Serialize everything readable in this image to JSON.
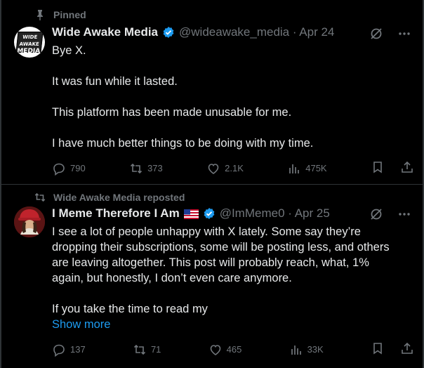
{
  "post1": {
    "context": "Pinned",
    "avatar_text_top": "WIDE AWAKE",
    "avatar_text_bottom": "MEDIA",
    "name": "Wide Awake Media",
    "handle": "@wideawake_media · Apr 24",
    "lines": [
      "Bye X.",
      "It was fun while it lasted.",
      "This platform has been made unusable for me.",
      "I have much better things to be doing with my time."
    ],
    "replies": "790",
    "reposts": "373",
    "likes": "2.1K",
    "views": "475K"
  },
  "post2": {
    "context": "Wide Awake Media reposted",
    "name": "I Meme Therefore I Am",
    "handle": "@ImMeme0 · Apr 25",
    "lines": [
      "I see a lot of people unhappy with X lately. Some say they’re",
      "dropping their subscriptions, some will be posting less, and others",
      "are leaving altogether. This post will probably reach, what, 1%",
      "again, but honestly, I don’t even care anymore.",
      "If you take the time to read my"
    ],
    "show_more": "Show more",
    "replies": "137",
    "reposts": "71",
    "likes": "465",
    "views": "33K"
  },
  "colors": {
    "accent": "#1d9bf0",
    "muted": "#71767b",
    "text": "#e7e9ea",
    "border": "#2f3336"
  }
}
